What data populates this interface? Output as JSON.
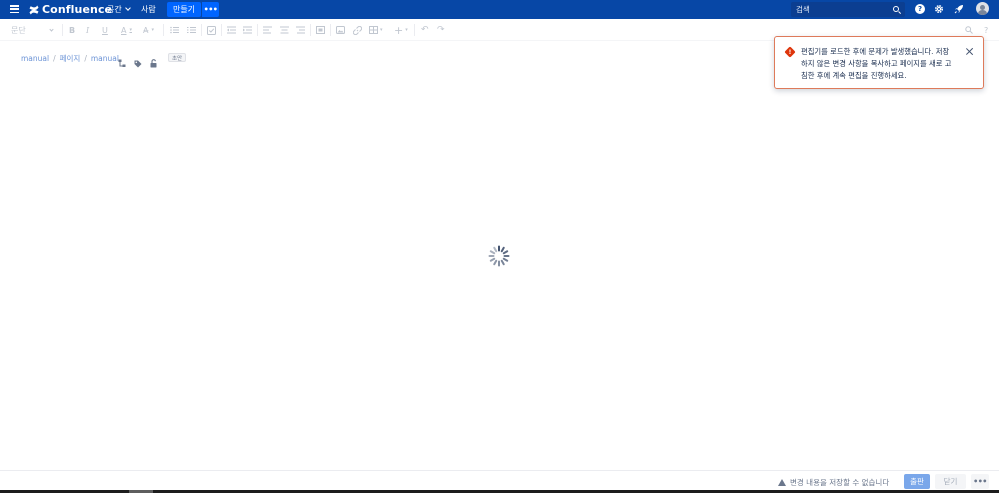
{
  "topnav": {
    "brand": "Confluence",
    "spaces_label": "공간",
    "people_label": "사람",
    "create_label": "만들기",
    "more_label": "•••",
    "search_placeholder": "검색",
    "help_label": "?",
    "colors": {
      "nav_bg": "#0747a6",
      "create_bg": "#0065ff"
    }
  },
  "toolbar": {
    "style_label": "문단",
    "icons": [
      "bold-icon",
      "italic-icon",
      "underline-icon",
      "text-color-icon",
      "format-icon",
      "bullet-list-icon",
      "numbered-list-icon",
      "task-list-icon",
      "outdent-icon",
      "indent-icon",
      "align-left-icon",
      "align-center-icon",
      "align-right-icon",
      "layout-icon",
      "image-icon",
      "link-icon",
      "table-icon",
      "insert-icon",
      "undo-icon",
      "redo-icon",
      "find-icon",
      "help-icon"
    ]
  },
  "breadcrumb": {
    "items": [
      "manual",
      "페이지",
      "manual"
    ],
    "separator": "/",
    "draft_badge": "초안"
  },
  "error_flag": {
    "message": "편집기를 로드한 후에 문제가 발생했습니다. 저장하지 않은 변경 사항을 복사하고 페이지를 새로 고침한 후에 계속 편집을 진행하세요.",
    "color": "#de350b"
  },
  "footer": {
    "warning": "변경 내용을 저장할 수 없습니다",
    "publish_label": "출판",
    "close_label": "닫기",
    "more_label": "•••"
  }
}
